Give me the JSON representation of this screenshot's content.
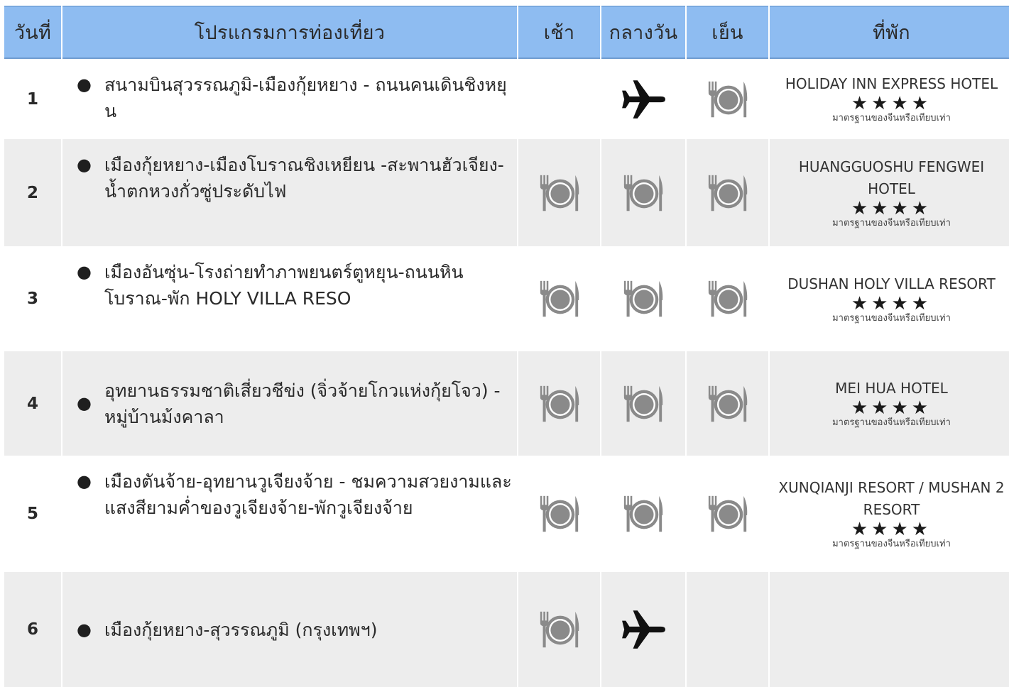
{
  "headers": {
    "day": "วันที่",
    "program": "โปรแกรมการท่องเที่ยว",
    "breakfast": "เช้า",
    "lunch": "กลางวัน",
    "dinner": "เย็น",
    "hotel": "ที่พัก"
  },
  "rows": [
    {
      "day": "1",
      "program": "สนามบินสุวรรณภูมิ-เมืองกุ้ยหยาง - ถนนคนเดินชิงหยุน",
      "hotel": "HOLIDAY INN EXPRESS HOTEL",
      "stars": "★★★★",
      "standard": "มาตรฐานของจีนหรือเทียบเท่า"
    },
    {
      "day": "2",
      "program": "เมืองกุ้ยหยาง-เมืองโบราณชิงเหยียน -สะพานฮัวเจียง-น้ำตกหวงกั่วซู่ประดับไฟ",
      "hotel": "HUANGGUOSHU FENGWEI HOTEL",
      "stars": "★★★★",
      "standard": "มาตรฐานของจีนหรือเทียบเท่า"
    },
    {
      "day": "3",
      "program": "เมืองอันซุ่น-โรงถ่ายทำภาพยนตร์ตูหยุน-ถนนหินโบราณ-พัก HOLY VILLA RESO",
      "hotel": "DUSHAN HOLY VILLA RESORT",
      "stars": "★★★★",
      "standard": "มาตรฐานของจีนหรือเทียบเท่า"
    },
    {
      "day": "4",
      "program": "อุทยานธรรมชาติเสี่ยวชีข่ง (จิ่วจ้ายโกวแห่งกุ้ยโจว) - หมู่บ้านม้งคาลา",
      "hotel": "MEI HUA HOTEL",
      "stars": "★★★★",
      "standard": "มาตรฐานของจีนหรือเทียบเท่า"
    },
    {
      "day": "5",
      "program": "เมืองตันจ้าย-อุทยานวูเจียงจ้าย - ชมความสวยงามและแสงสียามค่ำของวูเจียงจ้าย-พักวูเจียงจ้าย",
      "hotel": "XUNQIANJI RESORT / MUSHAN 2 RESORT",
      "stars": "★★★★",
      "standard": "มาตรฐานของจีนหรือเทียบเท่า"
    },
    {
      "day": "6",
      "program": "เมืองกุ้ยหยาง-สุวรรณภูมิ (กรุงเทพฯ)",
      "hotel": "",
      "stars": "",
      "standard": ""
    }
  ],
  "meals": [
    [
      "none",
      "plane-icon",
      "meal-icon"
    ],
    [
      "meal-icon",
      "meal-icon",
      "meal-icon"
    ],
    [
      "meal-icon",
      "meal-icon",
      "meal-icon"
    ],
    [
      "meal-icon",
      "meal-icon",
      "meal-icon"
    ],
    [
      "meal-icon",
      "meal-icon",
      "meal-icon"
    ],
    [
      "meal-icon",
      "plane-icon",
      "none"
    ]
  ],
  "colors": {
    "header_bg": "#8ebcf1",
    "row_alt_bg": "#ededed",
    "icon_gray": "#8a8a8a"
  }
}
